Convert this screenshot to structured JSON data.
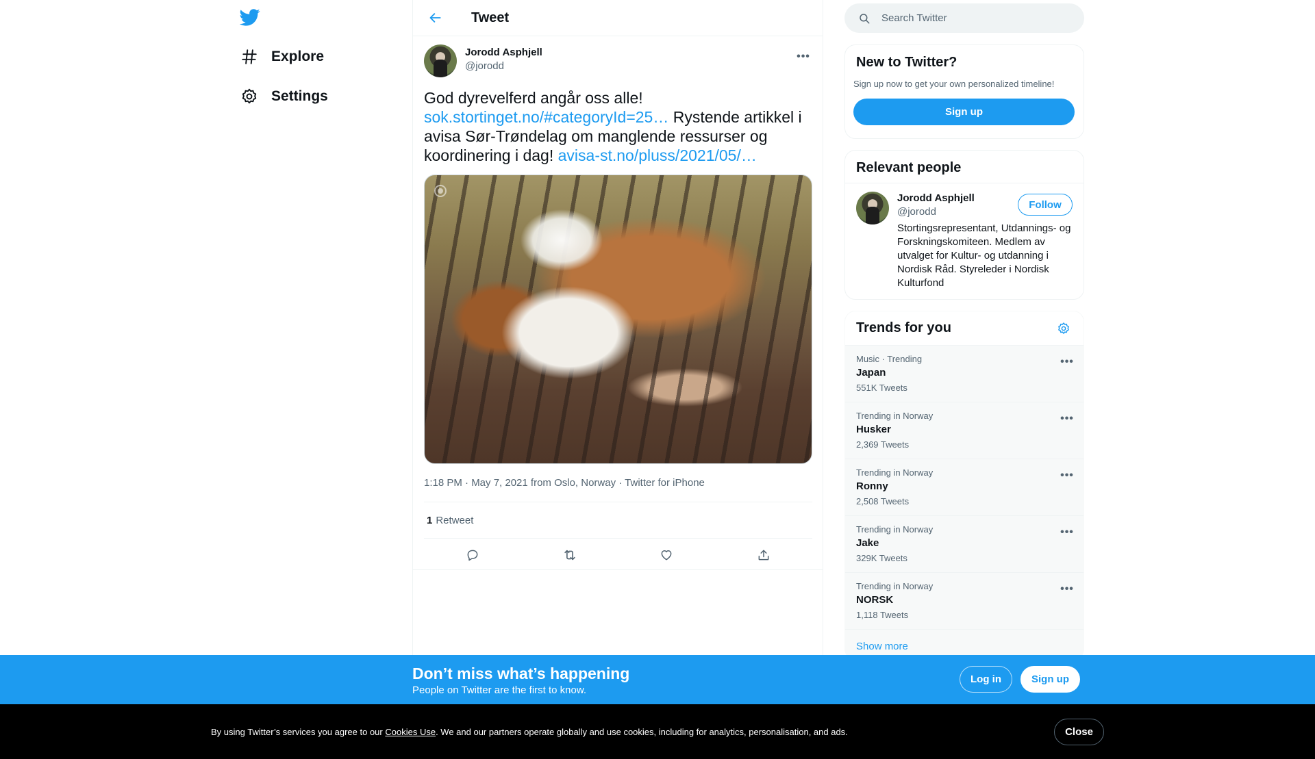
{
  "nav": {
    "explore_label": "Explore",
    "settings_label": "Settings"
  },
  "header": {
    "title": "Tweet"
  },
  "tweet": {
    "author_name": "Jorodd Asphjell",
    "author_handle": "@jorodd",
    "text_part1": "God dyrevelferd angår oss alle! ",
    "link1": "sok.stortinget.no/#categoryId=25…",
    "text_part2": " Rystende artikkel i avisa Sør-Trøndelag om manglende ressurser og koordinering i dag! ",
    "link2": "avisa-st.no/pluss/2021/05/…",
    "meta": "1:18 PM · May 7, 2021 from Oslo, Norway · Twitter for iPhone",
    "retweet_count": "1",
    "retweet_label": "Retweet"
  },
  "search": {
    "placeholder": "Search Twitter"
  },
  "new_to_twitter": {
    "title": "New to Twitter?",
    "subtitle": "Sign up now to get your own personalized timeline!",
    "signup_label": "Sign up"
  },
  "relevant_people": {
    "title": "Relevant people",
    "person": {
      "name": "Jorodd Asphjell",
      "handle": "@jorodd",
      "bio": "Stortingsrepresentant, Utdannings- og Forskningskomiteen. Medlem av utvalget for Kultur- og utdanning i Nordisk Råd. Styreleder i Nordisk Kulturfond",
      "follow_label": "Follow"
    }
  },
  "trends": {
    "title": "Trends for you",
    "items": [
      {
        "context": "Music · Trending",
        "name": "Japan",
        "count": "551K Tweets"
      },
      {
        "context": "Trending in Norway",
        "name": "Husker",
        "count": "2,369 Tweets"
      },
      {
        "context": "Trending in Norway",
        "name": "Ronny",
        "count": "2,508 Tweets"
      },
      {
        "context": "Trending in Norway",
        "name": "Jake",
        "count": "329K Tweets"
      },
      {
        "context": "Trending in Norway",
        "name": "NORSK",
        "count": "1,118 Tweets"
      }
    ],
    "show_more": "Show more"
  },
  "banner": {
    "title": "Don’t miss what’s happening",
    "subtitle": "People on Twitter are the first to know.",
    "login_label": "Log in",
    "signup_label": "Sign up"
  },
  "cookie": {
    "text_before": "By using Twitter’s services you agree to our ",
    "link": "Cookies Use",
    "text_after": ". We and our partners operate globally and use cookies, including for analytics, personalisation, and ads.",
    "close_label": "Close"
  },
  "colors": {
    "accent": "#1d9bf0",
    "text_primary": "#0f1419",
    "text_secondary": "#536471",
    "border": "#eff3f4",
    "cookie_bg": "#000000"
  },
  "icons": {
    "logo": "twitter-bird-icon",
    "explore": "hashtag-icon",
    "settings": "gear-icon",
    "back": "arrow-left-icon",
    "more": "ellipsis-icon",
    "search": "search-icon",
    "reply": "reply-icon",
    "retweet": "retweet-icon",
    "like": "heart-icon",
    "share": "share-icon"
  }
}
